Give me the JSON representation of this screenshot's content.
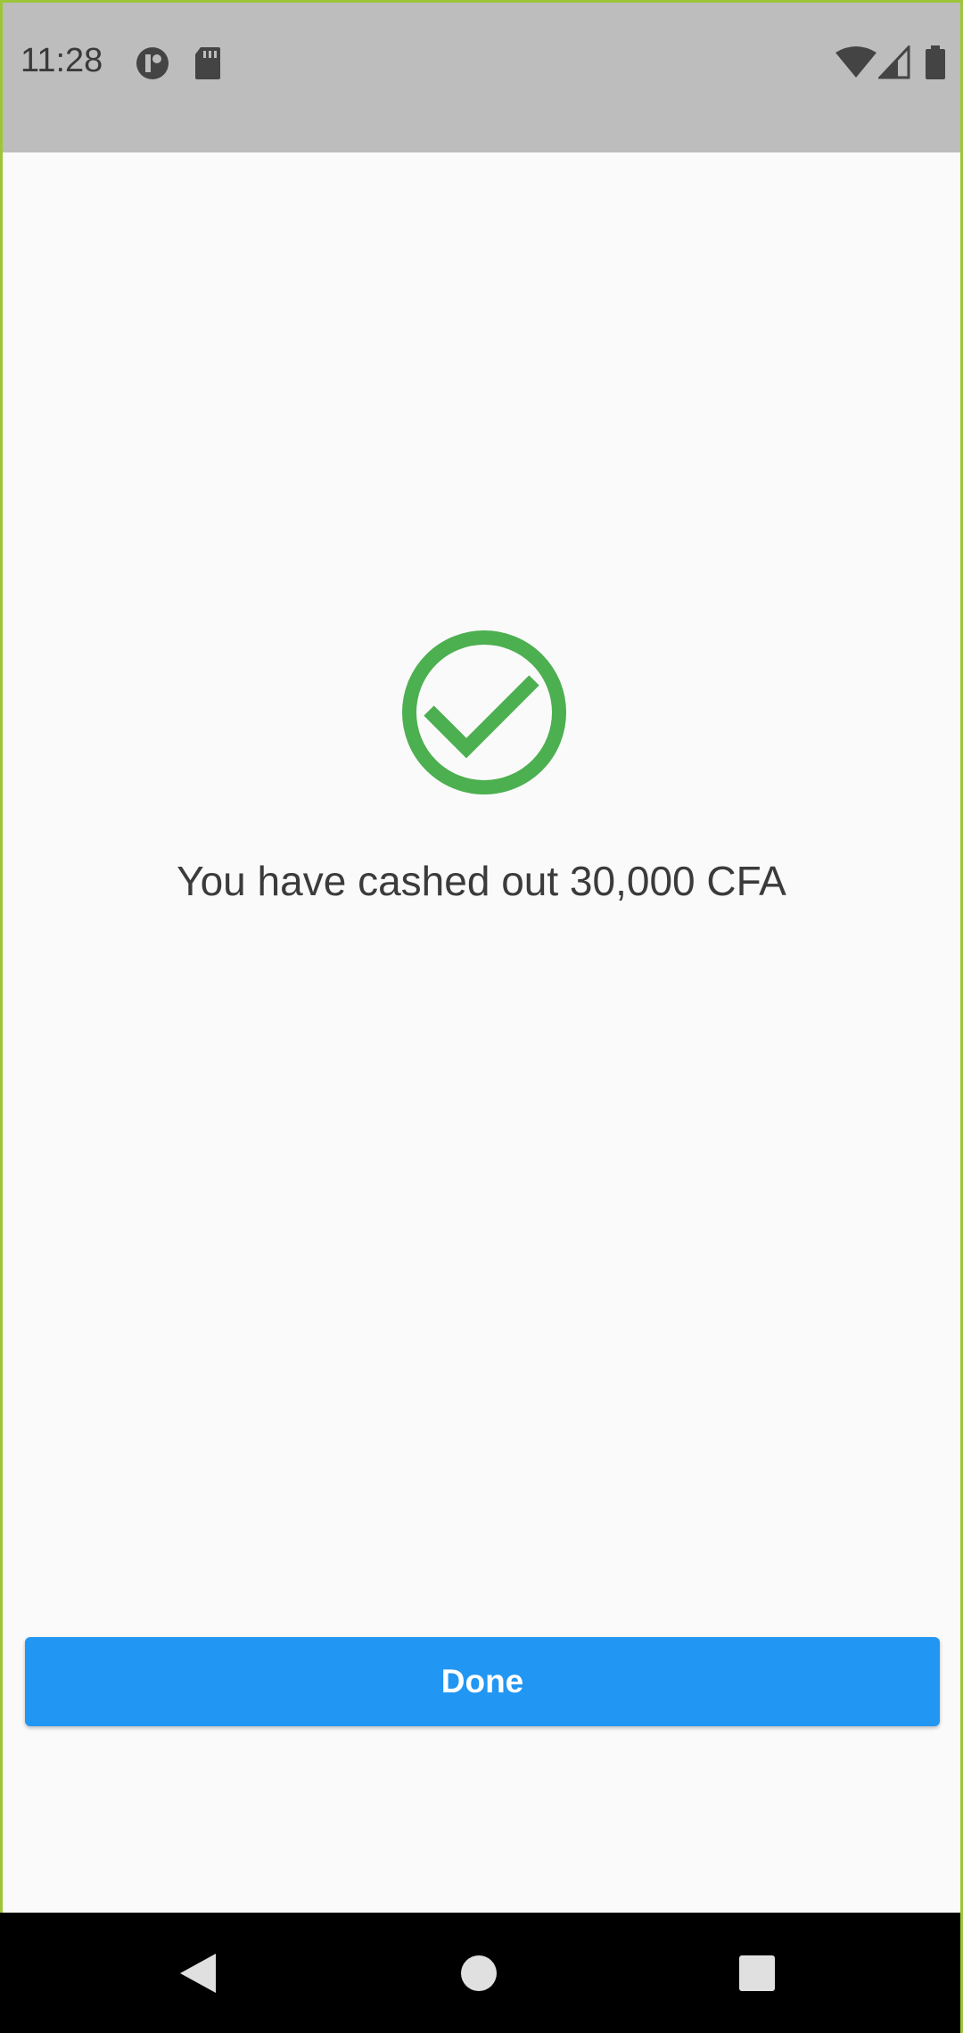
{
  "status_bar": {
    "time": "11:28",
    "left_icons": [
      "app-notification-icon",
      "sd-card-icon"
    ],
    "right_icons": [
      "wifi-icon",
      "signal-icon",
      "battery-icon"
    ]
  },
  "main": {
    "icon": "check-circle-icon",
    "message": "You have cashed out 30,000 CFA",
    "done_label": "Done"
  },
  "nav_bar": {
    "buttons": [
      "back-icon",
      "home-icon",
      "recents-icon"
    ]
  },
  "colors": {
    "accent": "#2196f3",
    "success": "#4caf50",
    "status_bar": "#bdbdbd",
    "background": "#fafafa"
  }
}
